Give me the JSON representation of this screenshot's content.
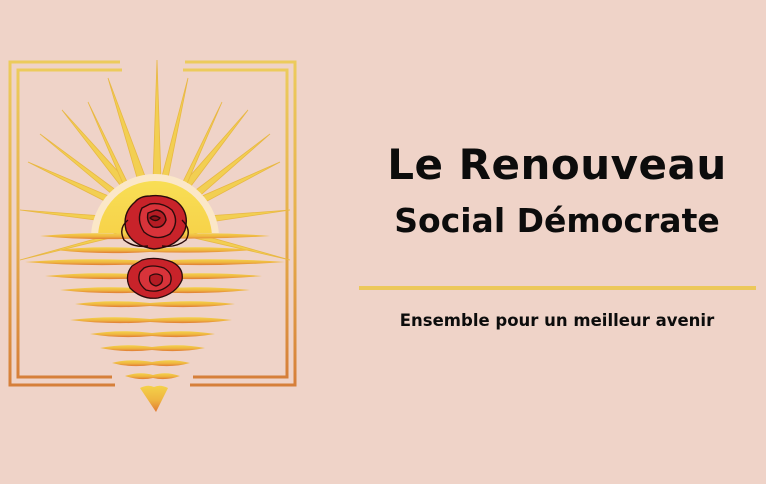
{
  "brand": {
    "title_line1": "Le Renouveau",
    "title_line2": "Social Démocrate",
    "tagline": "Ensemble pour un meilleur avenir"
  },
  "logo": {
    "icon": "sunset-rose-icon",
    "description_elements": [
      "sun-rays",
      "rising-sun",
      "red-rose",
      "rose-reflection",
      "water-ripples",
      "frame"
    ]
  },
  "colors": {
    "background": "#efd3c8",
    "text": "#0c0c0c",
    "accent_gold": "#ecc85a",
    "sun_yellow": "#f7d64a",
    "sun_orange": "#e9963d",
    "rose_red": "#c8232a",
    "frame_gold": "#e8c05a",
    "frame_orange": "#d9853c"
  }
}
